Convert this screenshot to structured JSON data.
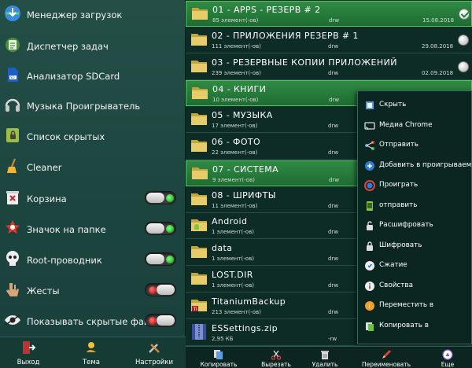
{
  "drawer": {
    "items": [
      {
        "label": "Менеджер загрузок",
        "icon": "download-manager-icon"
      },
      {
        "label": "Диспетчер задач",
        "icon": "task-manager-icon"
      },
      {
        "label": "Анализатор SDCard",
        "icon": "sdcard-icon"
      },
      {
        "label": "Музыка Проигрыватель",
        "icon": "headphones-icon"
      },
      {
        "label": "Список скрытых",
        "icon": "hidden-list-icon"
      },
      {
        "label": "Cleaner",
        "icon": "broom-icon"
      },
      {
        "label": "Корзина",
        "icon": "trash-icon",
        "toggle": "on"
      },
      {
        "label": "Значок на папке",
        "icon": "folder-badge-icon",
        "toggle": "on"
      },
      {
        "label": "Root-проводник",
        "icon": "skull-icon",
        "toggle": "on"
      },
      {
        "label": "Жесты",
        "icon": "gesture-hand-icon",
        "toggle": "off"
      },
      {
        "label": "Показывать скрытые файлы",
        "icon": "eye-icon",
        "toggle": "off"
      }
    ],
    "bottom": [
      {
        "label": "Выход",
        "icon": "exit-icon"
      },
      {
        "label": "Тема",
        "icon": "theme-icon"
      },
      {
        "label": "Настройки",
        "icon": "settings-icon"
      }
    ]
  },
  "files": [
    {
      "name": "01 - APPS - РЕЗЕРВ # 2",
      "sub": "85 элемент(-ов)",
      "perm": "drw",
      "date": "15.08.2018",
      "selected": true,
      "checked": true,
      "type": "folder"
    },
    {
      "name": "02 - ПРИЛОЖЕНИЯ РЕЗЕРВ # 1",
      "sub": "111 элемент(-ов)",
      "perm": "drw",
      "date": "29.08.2018",
      "type": "folder"
    },
    {
      "name": "03 - РЕЗЕРВНЫЕ КОПИИ ПРИЛОЖЕНИЙ",
      "sub": "239 элемент(-ов)",
      "perm": "drw",
      "date": "02.09.2018",
      "type": "folder"
    },
    {
      "name": "04 - КНИГИ",
      "sub": "10 элемент(-ов)",
      "perm": "drw",
      "date": "",
      "selected": true,
      "type": "folder"
    },
    {
      "name": "05 - МУЗЫКА",
      "sub": "17 элемент(-ов)",
      "perm": "drw",
      "date": "",
      "type": "folder"
    },
    {
      "name": "06 - ФОТО",
      "sub": "22 элемент(-ов)",
      "perm": "drw",
      "date": "",
      "type": "folder"
    },
    {
      "name": "07 - СИСТЕМА",
      "sub": "9 элемент(-ов)",
      "perm": "drw",
      "date": "",
      "selected": true,
      "type": "folder"
    },
    {
      "name": "08 - ШРИФТЫ",
      "sub": "11 элемент(-ов)",
      "perm": "drw",
      "date": "",
      "type": "folder"
    },
    {
      "name": "Android",
      "sub": "1 элемент(-ов)",
      "perm": "drw",
      "date": "",
      "type": "android"
    },
    {
      "name": "data",
      "sub": "1 элемент(-ов)",
      "perm": "drw",
      "date": "",
      "type": "folder"
    },
    {
      "name": "LOST.DIR",
      "sub": "1 элемент(-ов)",
      "perm": "drw",
      "date": "",
      "type": "folder"
    },
    {
      "name": "TitaniumBackup",
      "sub": "213 элемент(-ов)",
      "perm": "drw",
      "date": "",
      "type": "titanium"
    },
    {
      "name": "ESSettings.zip",
      "sub": "2,95 КБ",
      "perm": "-rw",
      "date": "",
      "type": "zip"
    }
  ],
  "menu": [
    {
      "label": "Скрыть",
      "icon": "hide-icon"
    },
    {
      "label": "Медиа Chrome",
      "icon": "cast-icon"
    },
    {
      "label": "Отправить",
      "icon": "share-icon"
    },
    {
      "label": "Добавить в проигрываемые",
      "icon": "playlist-add-icon"
    },
    {
      "label": "Проиграть",
      "icon": "play-icon"
    },
    {
      "label": "отправить",
      "icon": "send-icon"
    },
    {
      "label": "Расшифровать",
      "icon": "unlock-icon"
    },
    {
      "label": "Шифровать",
      "icon": "lock-icon"
    },
    {
      "label": "Сжатие",
      "icon": "compress-icon"
    },
    {
      "label": "Свойства",
      "icon": "info-icon"
    },
    {
      "label": "Переместить в",
      "icon": "move-icon"
    },
    {
      "label": "Копировать в",
      "icon": "copy-to-icon"
    }
  ],
  "toolbar": [
    {
      "label": "Копировать",
      "icon": "copy-icon"
    },
    {
      "label": "Вырезать",
      "icon": "cut-icon"
    },
    {
      "label": "Удалить",
      "icon": "delete-icon"
    },
    {
      "label": "Переименовать",
      "icon": "rename-icon"
    },
    {
      "label": "Еще",
      "icon": "more-icon"
    }
  ]
}
